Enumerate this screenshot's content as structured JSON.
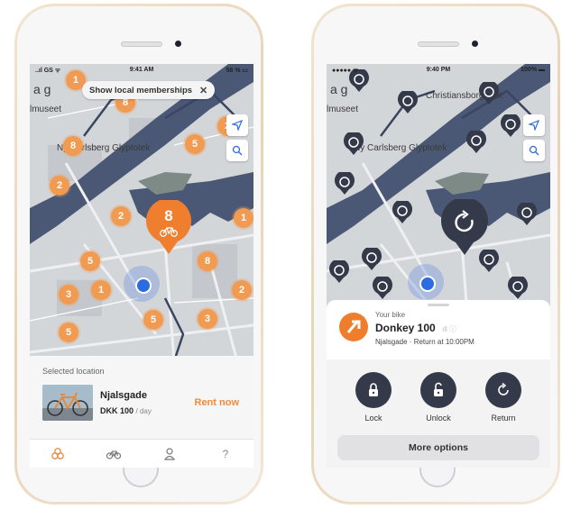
{
  "colors": {
    "accent": "#ef8b3b",
    "cluster": "#f09a52",
    "dark": "#343a49",
    "water": "#4b5875",
    "user": "#2c6be0"
  },
  "phone1": {
    "status": {
      "left": "..ıl GS ᯤ",
      "time": "9:41 AM",
      "right": "58 % ▭"
    },
    "membership_pill": {
      "label": "Show local memberships",
      "close_icon": "close-icon"
    },
    "map_labels": {
      "top": "a g",
      "museum": "lmuseet",
      "glyptotek": "Ny Carlsberg Glyptotek"
    },
    "clusters": [
      "1",
      "8",
      "2",
      "5",
      "8",
      "2",
      "2",
      "1",
      "5",
      "8",
      "3",
      "1",
      "2",
      "5",
      "3",
      "5"
    ],
    "selected_cluster": "8",
    "selected": {
      "title": "Selected location",
      "name": "Njalsgade",
      "price": "DKK 100",
      "unit": "/ day",
      "cta": "Rent now"
    },
    "tabs": [
      {
        "icon": "bikes-cluster-icon",
        "active": true
      },
      {
        "icon": "bike-icon",
        "active": false
      },
      {
        "icon": "profile-icon",
        "active": false
      },
      {
        "label": "?",
        "icon": "help-icon",
        "active": false
      }
    ]
  },
  "phone2": {
    "status": {
      "left": "●●●●● ᯤ",
      "time": "9:40 PM",
      "right": "100% ▬"
    },
    "map_labels": {
      "top": "a g",
      "museum": "lmuseet",
      "glyptotek": "Ny Carlsberg Glyptotek",
      "christiansborg": "Christiansborg Slot"
    },
    "bike": {
      "eyebrow": "Your bike",
      "name": "Donkey 100",
      "subtitle": "Njalsgade · Return at 10:00PM"
    },
    "actions": [
      {
        "label": "Lock",
        "icon": "lock-icon"
      },
      {
        "label": "Unlock",
        "icon": "unlock-icon"
      },
      {
        "label": "Return",
        "icon": "return-icon"
      }
    ],
    "more": "More options"
  }
}
